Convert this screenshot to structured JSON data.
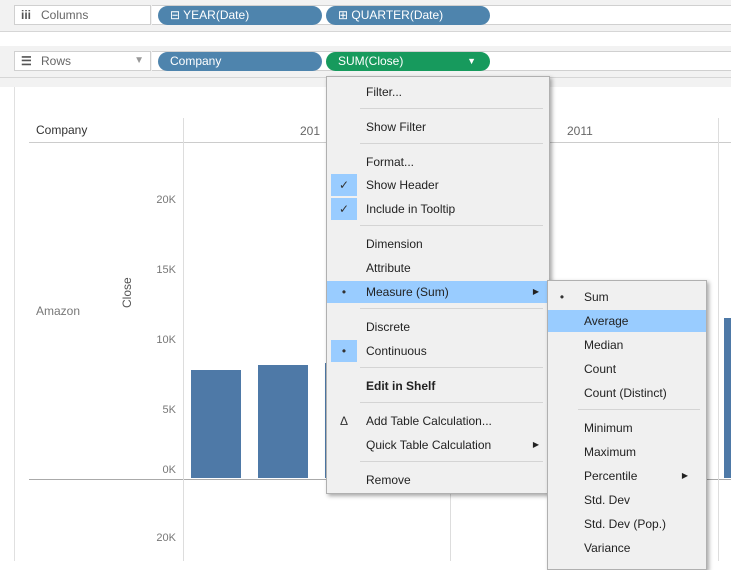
{
  "columns_shelf": {
    "label": "Columns",
    "icon": "columns-icon",
    "pills": [
      "⊟ YEAR(Date)",
      "⊞ QUARTER(Date)"
    ]
  },
  "rows_shelf": {
    "label": "Rows",
    "icon": "rows-icon",
    "pills": [
      "Company",
      "SUM(Close)"
    ]
  },
  "view": {
    "header_company": "Company",
    "header_year1": "201",
    "header_year2": "2011",
    "row_label": "Amazon",
    "axis_title": "Close",
    "ticks": [
      "20K",
      "15K",
      "10K",
      "5K",
      "0K"
    ],
    "tick_next": "20K"
  },
  "bar_values": [
    7700,
    8100,
    8200
  ],
  "context_menu": {
    "items": {
      "filter": "Filter...",
      "show_filter": "Show Filter",
      "format": "Format...",
      "show_header": "Show Header",
      "include_tooltip": "Include in Tooltip",
      "dimension": "Dimension",
      "attribute": "Attribute",
      "measure": "Measure (Sum)",
      "discrete": "Discrete",
      "continuous": "Continuous",
      "edit_in_shelf": "Edit in Shelf",
      "add_table_calc": "Add Table Calculation...",
      "quick_table_calc": "Quick Table Calculation",
      "remove": "Remove"
    },
    "marks": {
      "check": "✓",
      "bullet": "•",
      "delta": "Δ"
    }
  },
  "measure_submenu": {
    "items": {
      "sum": "Sum",
      "average": "Average",
      "median": "Median",
      "count": "Count",
      "count_distinct": "Count (Distinct)",
      "minimum": "Minimum",
      "maximum": "Maximum",
      "percentile": "Percentile",
      "std_dev": "Std. Dev",
      "std_dev_pop": "Std. Dev (Pop.)",
      "variance": "Variance"
    }
  },
  "colors": {
    "pill_blue": "#4e84ad",
    "pill_green": "#179a5d",
    "bar": "#4e79a7",
    "highlight": "#99ccff"
  }
}
